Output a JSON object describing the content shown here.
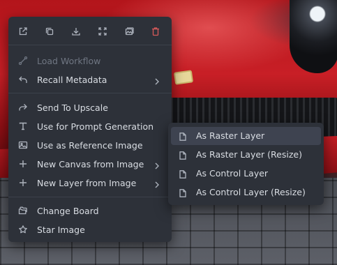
{
  "colors": {
    "menu_bg": "#2d3139",
    "text": "#d9dde3",
    "disabled_text": "#6f7682",
    "icon": "#aeb4be",
    "delete_icon": "#d65a5a",
    "active_bg": "#3e4350"
  },
  "toolbar": {
    "icons": [
      "open-in-new-tab-icon",
      "copy-icon",
      "download-icon",
      "fullscreen-icon",
      "gallery-icon",
      "trash-icon"
    ]
  },
  "menu": {
    "items": [
      {
        "label": "Load Workflow",
        "icon": "flow-icon",
        "disabled": true
      },
      {
        "label": "Recall Metadata",
        "icon": "undo-icon",
        "submenu": true
      },
      {
        "label": "Send To Upscale",
        "icon": "share-arrow-icon"
      },
      {
        "label": "Use for Prompt Generation",
        "icon": "text-t-icon"
      },
      {
        "label": "Use as Reference Image",
        "icon": "image-icon"
      },
      {
        "label": "New Canvas from Image",
        "icon": "plus-icon",
        "submenu": true
      },
      {
        "label": "New Layer from Image",
        "icon": "plus-icon",
        "submenu": true
      },
      {
        "label": "Change Board",
        "icon": "folders-icon"
      },
      {
        "label": "Star Image",
        "icon": "star-icon"
      }
    ]
  },
  "submenu": {
    "items": [
      {
        "label": "As Raster Layer",
        "icon": "file-icon",
        "active": true
      },
      {
        "label": "As Raster Layer (Resize)",
        "icon": "file-icon"
      },
      {
        "label": "As Control Layer",
        "icon": "file-icon"
      },
      {
        "label": "As Control Layer (Resize)",
        "icon": "file-icon"
      }
    ]
  }
}
